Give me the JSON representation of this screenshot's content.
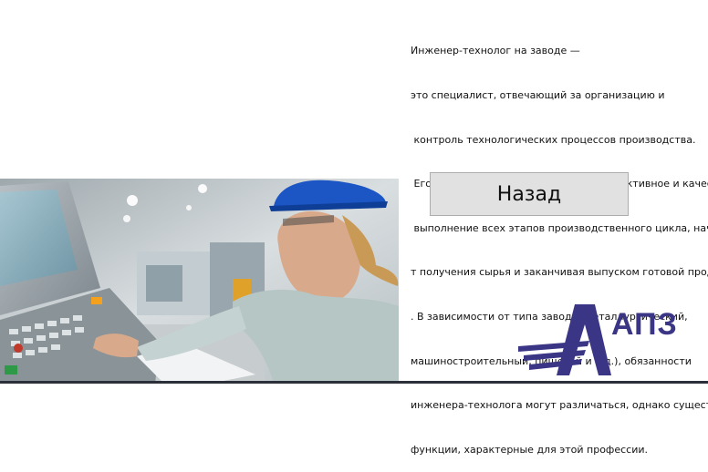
{
  "description": {
    "lines": [
      "Инженер-технолог на заводе —",
      "это специалист, отвечающий за организацию и",
      " контроль технологических процессов производства.",
      " Его главная задача — обеспечить эффективное и качествен",
      " выполнение всех этапов производственного цикла, начин",
      "т получения сырья и заканчивая выпуском готовой продук",
      ". В зависимости от типа завода (металлургический,",
      "машиностроительный, пищевой и т.д.), обязанности",
      "инженера-технолога могут различаться, однако существую",
      "функции, характерные для этой профессии."
    ]
  },
  "buttons": {
    "back_label": "Назад"
  },
  "logo": {
    "text": "АПЗ",
    "color": "#3a3585"
  },
  "photo": {
    "icon": "engineer-at-control-panel-photo"
  }
}
